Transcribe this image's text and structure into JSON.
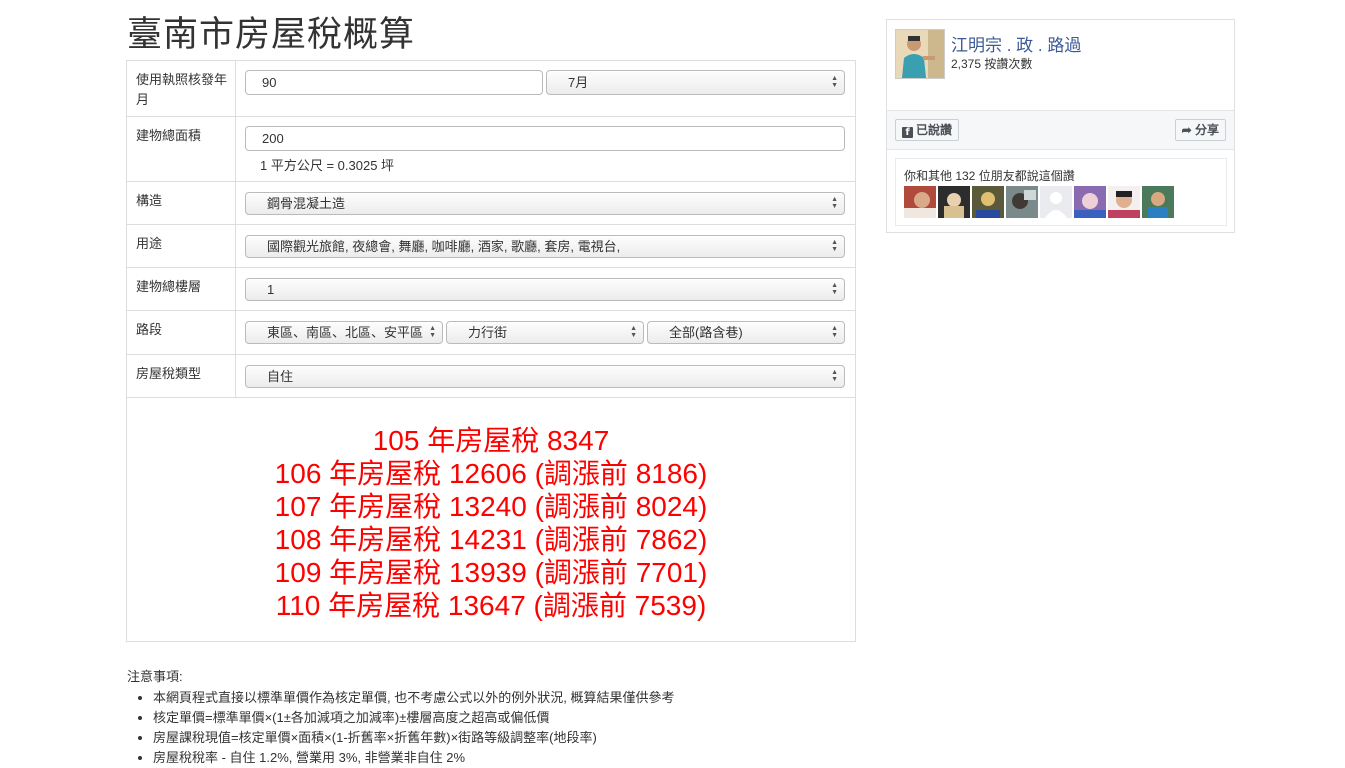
{
  "page_title": "臺南市房屋稅概算",
  "form": {
    "license_date_label": "使用執照核發年月",
    "license_year_value": "90",
    "license_month_value": "7月",
    "area_label": "建物總面積",
    "area_value": "200",
    "area_hint": "1 平方公尺 = 0.3025 坪",
    "structure_label": "構造",
    "structure_value": "鋼骨混凝土造",
    "usage_label": "用途",
    "usage_value": "國際觀光旅館, 夜總會, 舞廳, 咖啡廳, 酒家, 歌廳, 套房, 電視台,",
    "floors_label": "建物總樓層",
    "floors_value": "1",
    "road_label": "路段",
    "road_district_value": "東區、南區、北區、安平區",
    "road_street_value": "力行街",
    "road_section_value": "全部(路含巷)",
    "tax_type_label": "房屋稅類型",
    "tax_type_value": "自住"
  },
  "results": [
    "105 年房屋稅 8347",
    "106 年房屋稅 12606 (調漲前 8186)",
    "107 年房屋稅 13240 (調漲前 8024)",
    "108 年房屋稅 14231 (調漲前 7862)",
    "109 年房屋稅 13939 (調漲前 7701)",
    "110 年房屋稅 13647 (調漲前 7539)"
  ],
  "notes": {
    "title": "注意事項:",
    "items": [
      "本網頁程式直接以標準單價作為核定單價, 也不考慮公式以外的例外狀況, 概算結果僅供參考",
      "核定單價=標準單價×(1±各加減項之加減率)±樓層高度之超高或偏低價",
      "房屋課稅現值=核定單價×面積×(1-折舊率×折舊年數)×街路等級調整率(地段率)",
      "房屋稅稅率 - 自住 1.2%, 營業用 3%, 非營業非自住 2%"
    ]
  },
  "fb": {
    "page_name": "江明宗 . 政 . 路過",
    "like_count": "2,375 按讚次數",
    "liked_label": "已說讚",
    "share_label": "分享",
    "friends_text": "你和其他 132 位朋友都說這個讚"
  },
  "colors": {
    "result_red": "#ff0000",
    "fb_blue": "#3b5998"
  }
}
